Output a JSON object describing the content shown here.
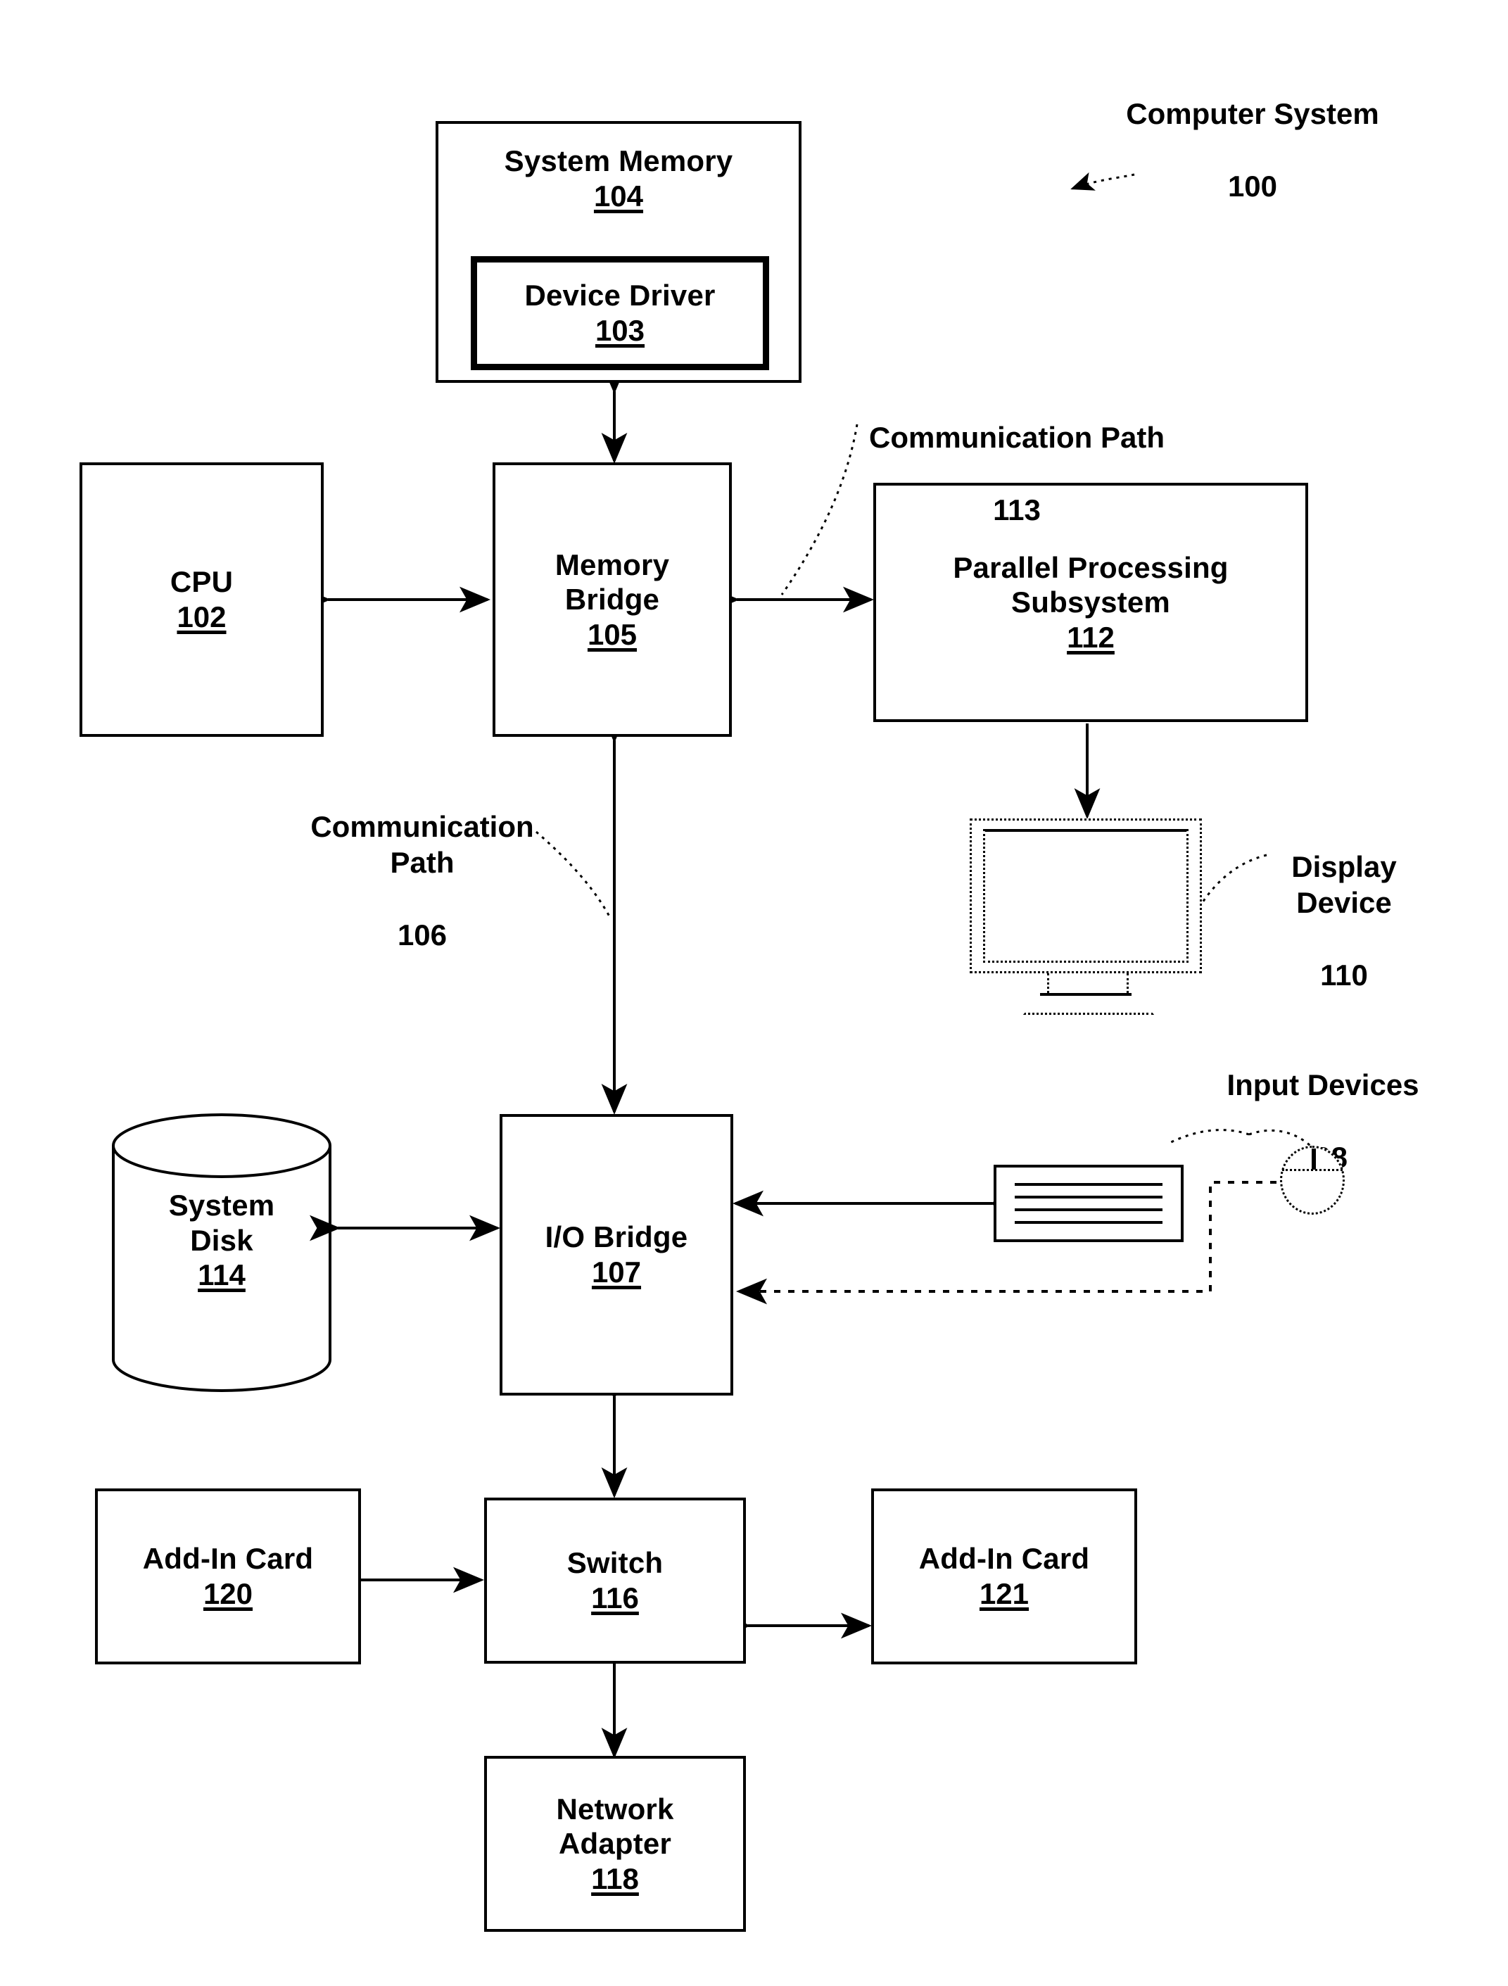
{
  "figure": {
    "title_annotation": "Computer System",
    "title_number": "100"
  },
  "blocks": {
    "system_memory": {
      "label": "System Memory",
      "number": "104"
    },
    "device_driver": {
      "label": "Device Driver",
      "number": "103"
    },
    "cpu": {
      "label": "CPU",
      "number": "102"
    },
    "memory_bridge": {
      "label": "Memory\nBridge",
      "number": "105"
    },
    "parallel_processing_subsystem": {
      "label": "Parallel Processing\nSubsystem",
      "number": "112"
    },
    "io_bridge": {
      "label": "I/O Bridge",
      "number": "107"
    },
    "system_disk": {
      "label": "System\nDisk",
      "number": "114"
    },
    "switch": {
      "label": "Switch",
      "number": "116"
    },
    "add_in_card_120": {
      "label": "Add-In Card",
      "number": "120"
    },
    "add_in_card_121": {
      "label": "Add-In Card",
      "number": "121"
    },
    "network_adapter": {
      "label": "Network\nAdapter",
      "number": "118"
    }
  },
  "annotations": {
    "communication_path_113": {
      "label": "Communication Path",
      "number": "113"
    },
    "communication_path_106": {
      "label": "Communication\nPath",
      "number": "106"
    },
    "display_device": {
      "label": "Display\nDevice",
      "number": "110"
    },
    "input_devices": {
      "label": "Input Devices",
      "number": "108"
    }
  },
  "icons": {
    "display_device": "monitor-icon",
    "keyboard": "keyboard-icon",
    "mouse": "mouse-icon",
    "system_disk": "database-cylinder-icon"
  },
  "colors": {
    "line": "#000000",
    "background": "#ffffff"
  }
}
